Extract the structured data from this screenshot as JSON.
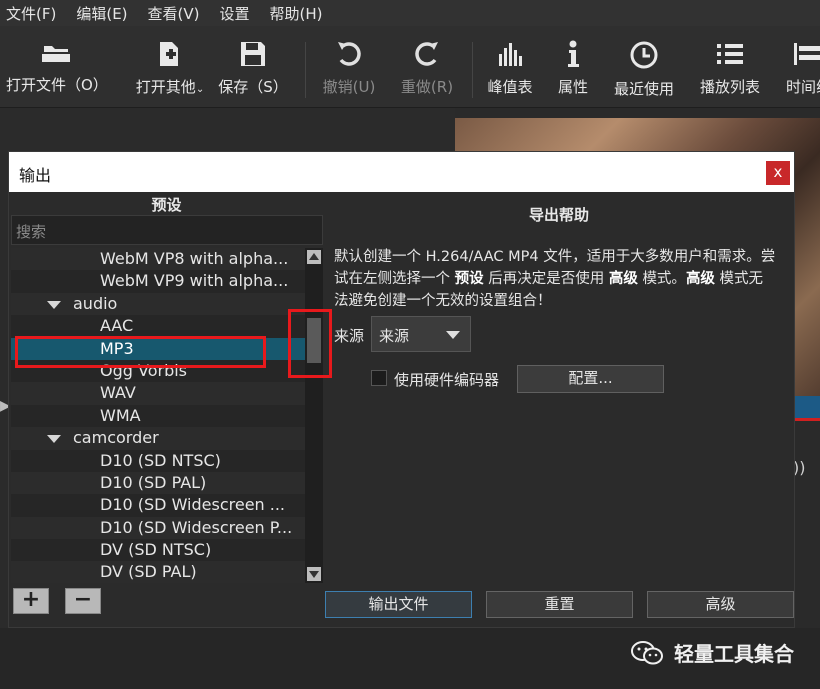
{
  "menu": [
    "文件(F)",
    "编辑(E)",
    "查看(V)",
    "设置",
    "帮助(H)"
  ],
  "toolbar": {
    "open_file": "打开文件（O）",
    "open_other": "打开其他",
    "save": "保存（S）",
    "undo": "撤销(U)",
    "redo": "重做(R)",
    "peak_meter": "峰值表",
    "properties": "属性",
    "recent": "最近使用",
    "playlist": "播放列表",
    "timeline": "时间线"
  },
  "dialog": {
    "title": "输出",
    "close": "x",
    "presets_header": "预设",
    "search_placeholder": "搜索",
    "tree": [
      {
        "label": "WebM VP8 with alpha...",
        "kind": "item"
      },
      {
        "label": "WebM VP9 with alpha...",
        "kind": "item"
      },
      {
        "label": "audio",
        "kind": "group"
      },
      {
        "label": "AAC",
        "kind": "item"
      },
      {
        "label": "MP3",
        "kind": "item",
        "selected": true
      },
      {
        "label": "Ogg Vorbis",
        "kind": "item"
      },
      {
        "label": "WAV",
        "kind": "item"
      },
      {
        "label": "WMA",
        "kind": "item"
      },
      {
        "label": "camcorder",
        "kind": "group"
      },
      {
        "label": "D10 (SD NTSC)",
        "kind": "item"
      },
      {
        "label": "D10 (SD PAL)",
        "kind": "item"
      },
      {
        "label": "D10 (SD Widescreen ...",
        "kind": "item"
      },
      {
        "label": "D10 (SD Widescreen P...",
        "kind": "item"
      },
      {
        "label": "DV (SD NTSC)",
        "kind": "item"
      },
      {
        "label": "DV (SD PAL)",
        "kind": "item"
      }
    ],
    "add_button": "+",
    "remove_button": "−",
    "help_title": "导出帮助",
    "help_line1": "默认创建一个 H.264/AAC MP4 文件，适用于大多数用户和需求。尝",
    "help_line2a": "试在左侧选择一个",
    "help_line2_bold1": "预设",
    "help_line2b": "后再决定是否使用",
    "help_line2_bold2": "高级",
    "help_line2c": "模式。",
    "help_line2_bold3": "高级",
    "help_line2d": "模式无",
    "help_line3": "法避免创建一个无效的设置组合！",
    "source_label": "来源",
    "source_value": "来源",
    "hw_encoder_label": "使用硬件编码器",
    "configure_button": "配置...",
    "export_button": "输出文件",
    "reset_button": "重置",
    "advanced_button": "高级"
  },
  "watermark": "轻量工具集合",
  "colors": {
    "selection": "#17586e",
    "highlight_box": "#e8191c",
    "close": "#c8282a"
  }
}
